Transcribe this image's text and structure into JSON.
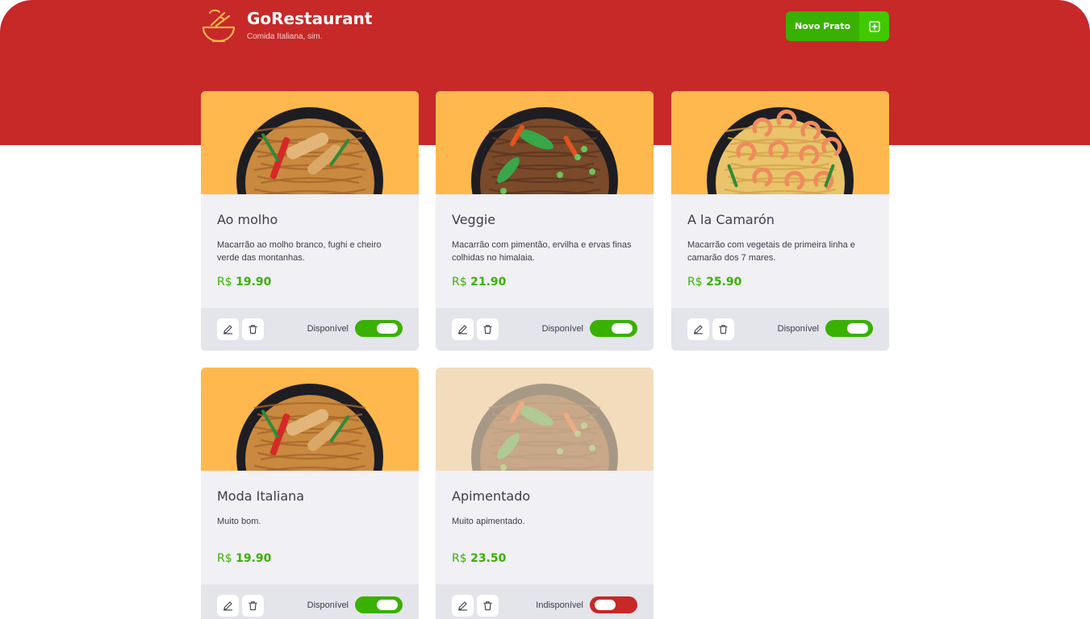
{
  "app": {
    "title": "GoRestaurant",
    "subtitle": "Comida Italiana, sim.",
    "logo_icon": "food-bowl-icon"
  },
  "header": {
    "new_button_label": "Novo Prato",
    "new_button_icon": "plus-square-icon",
    "background_color": "#c72828"
  },
  "colors": {
    "brand_red": "#c72828",
    "available_green": "#39b100",
    "image_background": "#ffb84d",
    "card_background": "#f0f0f5",
    "footer_background": "#e4e4eb"
  },
  "dishes": [
    {
      "name": "Ao molho",
      "description": "Macarrão ao molho branco, fughi e cheiro verde das montanhas.",
      "currency": "R$",
      "price": "19.90",
      "availability_label": "Disponível",
      "available": true,
      "image_icon": "pasta-chicken-bowl-image"
    },
    {
      "name": "Veggie",
      "description": "Macarrão com pimentão, ervilha e ervas finas colhidas no himalaia.",
      "currency": "R$",
      "price": "21.90",
      "availability_label": "Disponível",
      "available": true,
      "image_icon": "veggie-noodles-bowl-image"
    },
    {
      "name": "A la Camarón",
      "description": "Macarrão com vegetais de primeira linha e camarão dos 7 mares.",
      "currency": "R$",
      "price": "25.90",
      "availability_label": "Disponível",
      "available": true,
      "image_icon": "shrimp-noodles-bowl-image"
    },
    {
      "name": "Moda Italiana",
      "description": "Muito bom.",
      "currency": "R$",
      "price": "19.90",
      "availability_label": "Disponível",
      "available": true,
      "image_icon": "pasta-chicken-bowl-image"
    },
    {
      "name": "Apimentado",
      "description": "Muito apimentado.",
      "currency": "R$",
      "price": "23.50",
      "availability_label": "Indisponível",
      "available": false,
      "image_icon": "veggie-noodles-bowl-image"
    }
  ],
  "card_actions": {
    "edit_icon": "pencil-icon",
    "delete_icon": "trash-icon"
  }
}
